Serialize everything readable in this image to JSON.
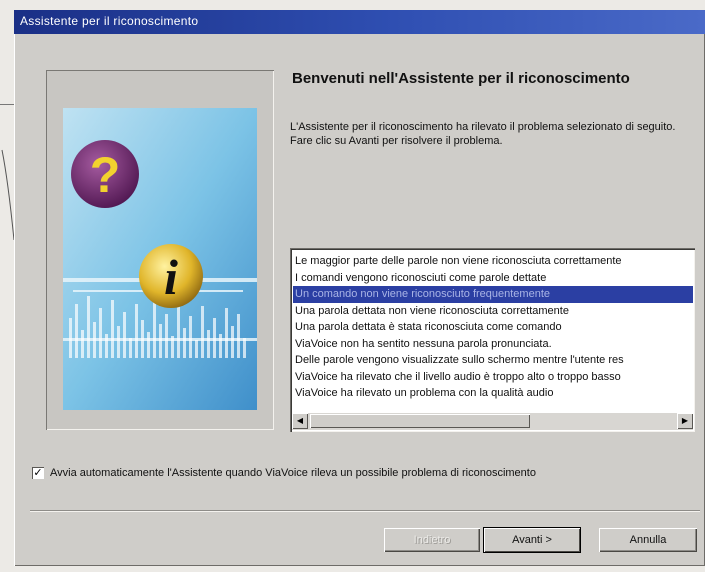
{
  "window": {
    "title": "Assistente per il riconoscimento"
  },
  "main": {
    "heading": "Benvenuti nell'Assistente per il riconoscimento",
    "intro": "L'Assistente per il riconoscimento ha rilevato il problema selezionato di seguito. Fare clic su Avanti per risolvere il problema.",
    "problems": [
      "Le maggior parte delle parole non viene riconosciuta correttamente",
      "I comandi vengono riconosciuti come parole dettate",
      "Un comando non viene riconosciuto frequentemente",
      "Una parola dettata non viene riconosciuta correttamente",
      "Una parola dettata è stata riconosciuta come comando",
      "ViaVoice non ha sentito nessuna parola pronunciata.",
      "Delle parole vengono visualizzate sullo schermo mentre l'utente res",
      "ViaVoice ha rilevato che il livello audio è troppo alto o troppo basso",
      "ViaVoice ha rilevato un problema con la qualità audio"
    ],
    "selected_index": 2,
    "autostart_checked": true,
    "autostart_label": "Avvia automaticamente l'Assistente quando ViaVoice rileva un possibile problema di riconoscimento"
  },
  "footer": {
    "back_label": "Indietro",
    "next_label": "Avanti >",
    "cancel_label": "Annulla"
  },
  "icons": {
    "question": "question-mark-icon",
    "info": "info-i-icon",
    "checkbox": "checkmark-icon",
    "scroll_left": "arrow-left-icon",
    "scroll_right": "arrow-right-icon"
  },
  "colors": {
    "title_bar": "#1a2f86",
    "selection": "#2b3fa3",
    "dialog_bg": "#cfcdc9",
    "question_badge": "#7a2a6e",
    "info_badge": "#d9b024"
  }
}
